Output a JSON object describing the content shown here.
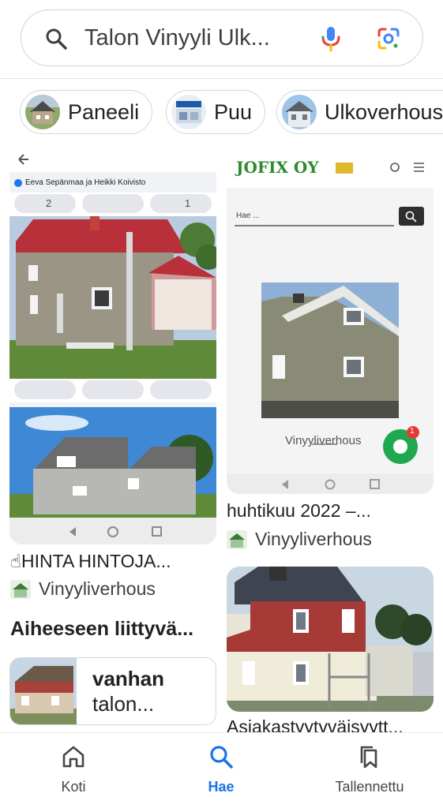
{
  "search": {
    "query": "Talon Vinyyli Ulk..."
  },
  "chips": [
    {
      "label": "Paneeli"
    },
    {
      "label": "Puu"
    },
    {
      "label": "Ulkoverhous"
    }
  ],
  "results": {
    "card1": {
      "post_author": "Eeva Sepänmaa ja Heikki Koivisto",
      "likes": "2",
      "shares": "1",
      "caption": "☝HINTA HINTOJA...",
      "source": "Vinyyliverhous"
    },
    "card2": {
      "site_logo": "JOFIX OY",
      "search_placeholder": "Hae ...",
      "product_label": "Vinyyliverhous",
      "chat_badge": "1",
      "caption": "huhtikuu 2022 –...",
      "source": "Vinyyliverhous"
    },
    "card3": {
      "caption": "Asiakastyytyväisyytt..."
    }
  },
  "related": {
    "heading": "Aiheeseen liittyvä...",
    "item_title": "vanhan",
    "item_subtitle": "talon..."
  },
  "nav": {
    "items": [
      {
        "label": "Koti",
        "icon": "home-icon"
      },
      {
        "label": "Hae",
        "icon": "search-icon"
      },
      {
        "label": "Tallennettu",
        "icon": "bookmarks-icon"
      }
    ],
    "active": "Hae",
    "active_color": "#1a73e8"
  }
}
